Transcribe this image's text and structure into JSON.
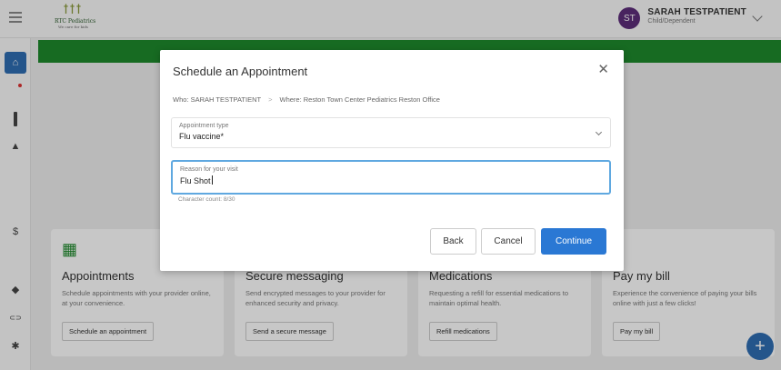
{
  "header": {
    "logo_glyph": "ꝉꝉꝉ",
    "logo_name": "RTC Pediatrics",
    "logo_tagline": "We care for kids",
    "user_initials": "ST",
    "user_name": "SARAH TESTPATIENT",
    "user_role": "Child/Dependent"
  },
  "sidebar": {
    "items": [
      {
        "icon": "home-icon",
        "active": true
      },
      {
        "icon": "mail-icon"
      },
      {
        "icon": "calendar-icon"
      },
      {
        "icon": "lab-icon"
      },
      {
        "icon": "edit-icon"
      },
      {
        "icon": "document-icon"
      },
      {
        "icon": "dollar-icon",
        "glyph": "$"
      },
      {
        "icon": "folder-icon"
      },
      {
        "icon": "medication-icon"
      },
      {
        "icon": "link-icon",
        "glyph": "⊂⊃"
      },
      {
        "icon": "gear-icon",
        "glyph": "✱"
      }
    ]
  },
  "cards": [
    {
      "icon_glyph": "▦",
      "title": "Appointments",
      "desc": "Schedule appointments with your provider online, at your convenience.",
      "button": "Schedule an appointment"
    },
    {
      "title": "Secure messaging",
      "desc": "Send encrypted messages to your provider for enhanced security and privacy.",
      "button": "Send a secure message"
    },
    {
      "title": "Medications",
      "desc": "Requesting a refill for essential medications to maintain optimal health.",
      "button": "Refill medications"
    },
    {
      "icon_glyph": "$",
      "title": "Pay my bill",
      "desc": "Experience the convenience of paying your bills online with just a few clicks!",
      "button": "Pay my bill"
    }
  ],
  "fab_label": "+",
  "modal": {
    "title": "Schedule an Appointment",
    "close_glyph": "✕",
    "who": "Who: SARAH TESTPATIENT",
    "crumb_sep": ">",
    "where": "Where: Reston Town Center Pediatrics Reston Office",
    "appointment_type_label": "Appointment type",
    "appointment_type_value": "Flu vaccine*",
    "reason_label": "Reason for your visit",
    "reason_value": "Flu Shot",
    "char_count": "Character count: 8/30",
    "back_label": "Back",
    "cancel_label": "Cancel",
    "continue_label": "Continue"
  },
  "colors": {
    "accent": "#2a78d4",
    "brand_green": "#1e8a2c",
    "avatar_bg": "#5d2d7a"
  }
}
